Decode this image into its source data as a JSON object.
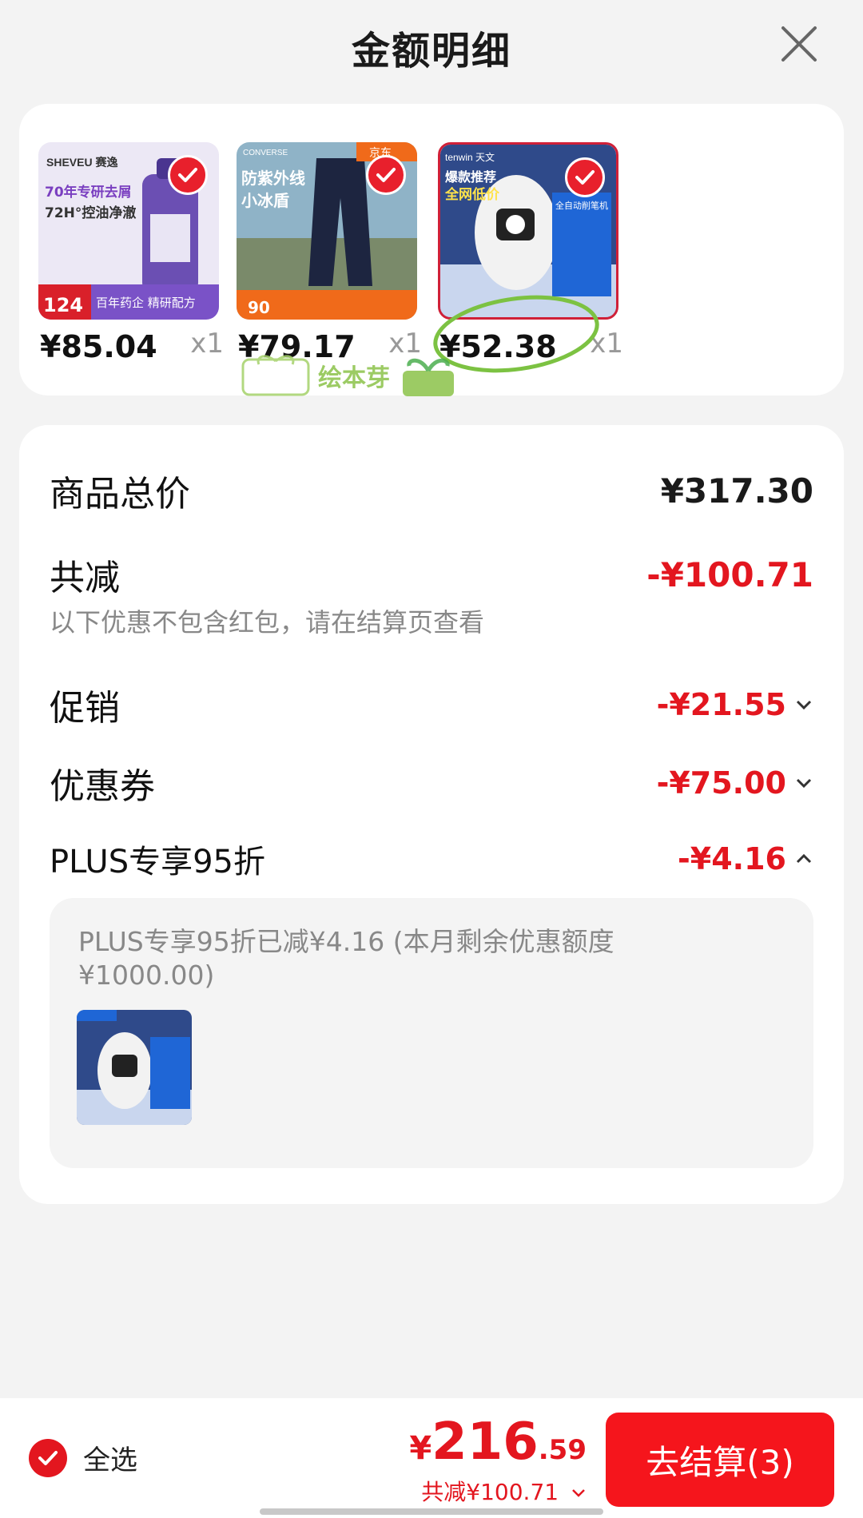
{
  "header": {
    "title": "金额明细",
    "close_icon": "close-icon"
  },
  "products": [
    {
      "price": "¥85.04",
      "qty": "x1",
      "brand": "SHEVEU 赛逸",
      "ad_line1": "70年专研去屑",
      "ad_line2": "72H°控油净澈",
      "tag": "百年药企 精研配方",
      "badge_price": "124"
    },
    {
      "price": "¥79.17",
      "qty": "x1",
      "brand": "CONVERSE",
      "ad_line1": "防紫外线",
      "ad_line2": "小冰盾",
      "tag": "京东",
      "badge_price": "90"
    },
    {
      "price": "¥52.38",
      "qty": "x1",
      "brand": "tenwin 天文",
      "ad_line1": "爆款推荐",
      "ad_line2": "全网低价",
      "tag": "全自动削笔机",
      "badge_price": ""
    }
  ],
  "watermark": {
    "text": "绘本芽"
  },
  "summary": {
    "goods_total_label": "商品总价",
    "goods_total_value": "¥317.30",
    "total_discount_label": "共减",
    "total_discount_value": "-¥100.71",
    "note": "以下优惠不包含红包，请在结算页查看",
    "promo_label": "促销",
    "promo_value": "-¥21.55",
    "coupon_label": "优惠券",
    "coupon_value": "-¥75.00",
    "plus_label": "PLUS专享95折",
    "plus_value": "-¥4.16",
    "plus_detail": "PLUS专享95折已减¥4.16 (本月剩余优惠额度¥1000.00)"
  },
  "bottom": {
    "select_all": "全选",
    "currency": "¥",
    "total_int": "216",
    "total_dec": ".59",
    "discount": "共减¥100.71",
    "checkout": "去结算(3)"
  },
  "colors": {
    "accent": "#e3161f",
    "button": "#f5151c",
    "bg": "#f3f3f3"
  }
}
